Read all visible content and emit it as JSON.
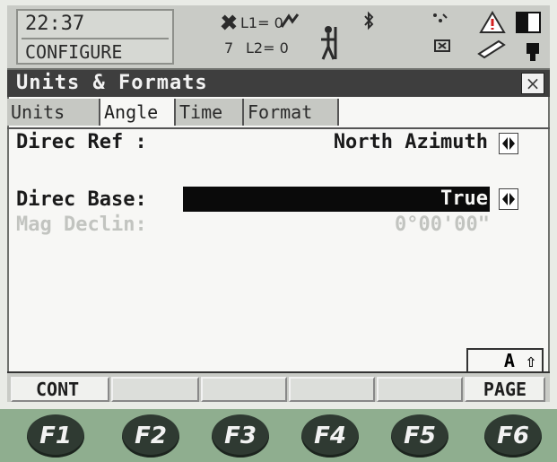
{
  "status": {
    "time": "22:37",
    "mode": "CONFIGURE",
    "satellites": "7",
    "l1": "L1= 0",
    "l2": "L2= 0",
    "icons": [
      "satellite-icon",
      "signal-icon",
      "surveyor-icon",
      "bluetooth-icon",
      "radio-icon",
      "warning-icon",
      "battery-icon",
      "pen-icon",
      "memory-icon"
    ]
  },
  "titlebar": {
    "title": "Units & Formats",
    "close_label": "×"
  },
  "tabs": [
    "Units",
    "Angle",
    "Time",
    "Format"
  ],
  "active_tab": "Angle",
  "fields": {
    "direc_ref": {
      "label": "Direc Ref :",
      "value": "North Azimuth"
    },
    "direc_base": {
      "label": "Direc Base:",
      "value": "True"
    },
    "mag_declin": {
      "label": "Mag Declin:",
      "value": "0°00'00\""
    }
  },
  "indicator": "A ⇧",
  "softkeys": [
    "CONT",
    "",
    "",
    "",
    "",
    "PAGE"
  ],
  "fkeys": [
    "F1",
    "F2",
    "F3",
    "F4",
    "F5",
    "F6"
  ]
}
